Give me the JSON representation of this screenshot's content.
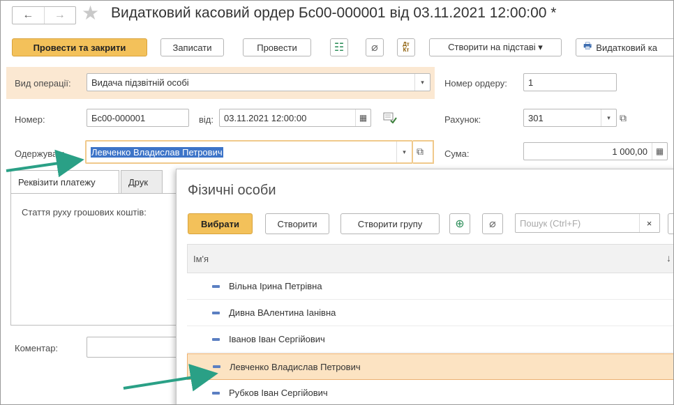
{
  "window": {
    "title": "Видатковий касовий ордер Бс00-000001 від 03.11.2021 12:00:00 *",
    "back_glyph": "←",
    "forward_glyph": "→",
    "star_glyph": "★"
  },
  "toolbar": {
    "post_close": "Провести та закрити",
    "save": "Записати",
    "post": "Провести",
    "structure_glyph": "☷",
    "attach_glyph": "⌀",
    "dt_kt": "Дт\nКт",
    "create_based": "Створити на підставі ▾",
    "print_glyph": "🖶",
    "print_label": "Видатковий ка"
  },
  "form": {
    "operation_label": "Вид операції:",
    "operation_value": "Видача підзвітній особі",
    "order_number_label": "Номер ордеру:",
    "order_number_value": "1",
    "number_label": "Номер:",
    "number_value": "Бс00-000001",
    "from_label": "від:",
    "date_value": "03.11.2021 12:00:00",
    "calendar_glyph": "▦",
    "account_label": "Рахунок:",
    "account_value": "301",
    "recipient_label": "Одержувач:",
    "recipient_value": "Левченко Владислав Петрович",
    "sum_label": "Сума:",
    "sum_value": "1 000,00",
    "calc_glyph": "▦",
    "dropdown_glyph": "▾",
    "open_glyph": "⧉",
    "comment_label": "Коментар:"
  },
  "tabs": [
    {
      "label": "Реквізити платежу"
    },
    {
      "label": "Друк"
    }
  ],
  "tab_content": {
    "cash_flow_label": "Стаття руху грошових коштів:"
  },
  "popup": {
    "title": "Фізичні особи",
    "select": "Вибрати",
    "create": "Створити",
    "create_group": "Створити групу",
    "new_glyph": "⊕",
    "attach_glyph": "⌀",
    "search_placeholder": "Пошук (Ctrl+F)",
    "clear_glyph": "×",
    "column_name": "Ім'я",
    "sort_glyph": "↓",
    "rows": [
      {
        "name": "Вільна Ірина Петрівна"
      },
      {
        "name": "Дивна ВАлентина Іанівна"
      },
      {
        "name": "Іванов Іван Сергійович"
      },
      {
        "name": "Левченко Владислав Петрович"
      },
      {
        "name": "Рубков Іван Сергійович"
      }
    ]
  },
  "colors": {
    "primary_button": "#f3c15a",
    "highlight_row": "#fce3c2",
    "selection_text_bg": "#3d74c8",
    "annotation_arrow": "#2aa086",
    "list_dash": "#5b7fc2"
  }
}
